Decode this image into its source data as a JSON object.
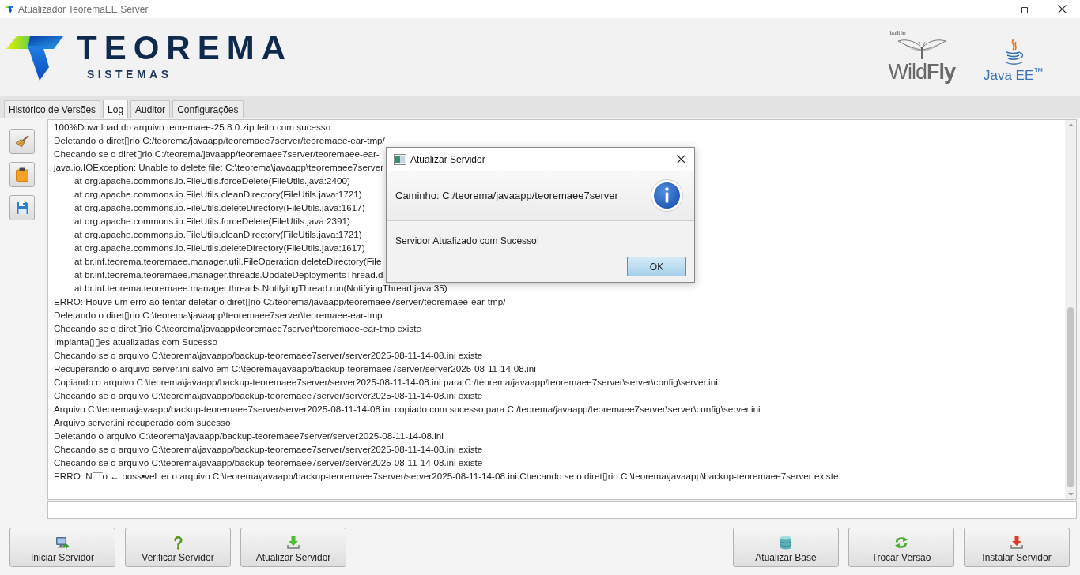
{
  "window": {
    "title": "Atualizador TeoremaEE Server"
  },
  "header": {
    "logo": {
      "name": "TEOREMA",
      "tagline": "SISTEMAS"
    },
    "badges": [
      {
        "kind": "wildfly",
        "caption": "built in",
        "name": "Wild**Fly**"
      },
      {
        "kind": "javaee",
        "name": "Java EE$^{™}$"
      }
    ]
  },
  "tabs": [
    {
      "label": "Histórico de Versões",
      "selected": false
    },
    {
      "label": "Log",
      "selected": true
    },
    {
      "label": "Auditor",
      "selected": false
    },
    {
      "label": "Configurações",
      "selected": false
    }
  ],
  "log": {
    "lines": [
      {
        "kind": "message",
        "text": "100%Download do arquivo teoremaee-25.8.0.zip feito com sucesso"
      },
      {
        "kind": "message",
        "text": "Deletando o diret▯rio C:/teorema/javaapp/teoremaee7server/teoremaee-ear-tmp/"
      },
      {
        "kind": "message",
        "text": "Checando se o diret▯rio C:/teorema/javaapp/teoremaee7server/teoremaee-ear-"
      },
      {
        "kind": "message",
        "text": "java.io.IOException: Unable to delete file: C:\\teorema\\javaapp\\teoremaee7server"
      },
      {
        "kind": "trace",
        "text": "at org.apache.commons.io.FileUtils.forceDelete(FileUtils.java:2400)"
      },
      {
        "kind": "trace",
        "text": "at org.apache.commons.io.FileUtils.cleanDirectory(FileUtils.java:1721)"
      },
      {
        "kind": "trace",
        "text": "at org.apache.commons.io.FileUtils.deleteDirectory(FileUtils.java:1617)"
      },
      {
        "kind": "trace",
        "text": "at org.apache.commons.io.FileUtils.forceDelete(FileUtils.java:2391)"
      },
      {
        "kind": "trace",
        "text": "at org.apache.commons.io.FileUtils.cleanDirectory(FileUtils.java:1721)"
      },
      {
        "kind": "trace",
        "text": "at org.apache.commons.io.FileUtils.deleteDirectory(FileUtils.java:1617)"
      },
      {
        "kind": "trace",
        "text": "at br.inf.teorema.teoremaee.manager.util.FileOperation.deleteDirectory(File"
      },
      {
        "kind": "trace",
        "text": "at br.inf.teorema.teoremaee.manager.threads.UpdateDeploymentsThread.d"
      },
      {
        "kind": "trace",
        "text": "at br.inf.teorema.teoremaee.manager.threads.NotifyingThread.run(NotifyingThread.java:35)"
      },
      {
        "kind": "message",
        "text": "ERRO: Houve um erro ao tentar deletar o diret▯rio C:/teorema/javaapp/teoremaee7server/teoremaee-ear-tmp/"
      },
      {
        "kind": "message",
        "text": "Deletando o diret▯rio C:\\teorema\\javaapp\\teoremaee7server\\teoremaee-ear-tmp"
      },
      {
        "kind": "message",
        "text": "Checando se o diret▯rio C:\\teorema\\javaapp\\teoremaee7server\\teoremaee-ear-tmp existe"
      },
      {
        "kind": "message",
        "text": "Implanta▯▯es atualizadas com Sucesso"
      },
      {
        "kind": "message",
        "text": "Checando se o arquivo C:\\teorema\\javaapp/backup-teoremaee7server/server2025-08-11-14-08.ini existe"
      },
      {
        "kind": "message",
        "text": "Recuperando o arquivo server.ini salvo em C:\\teorema\\javaapp/backup-teoremaee7server/server2025-08-11-14-08.ini"
      },
      {
        "kind": "message",
        "text": "Copiando o arquivo C:\\teorema\\javaapp/backup-teoremaee7server/server2025-08-11-14-08.ini para C:/teorema/javaapp/teoremaee7server\\server\\config\\server.ini"
      },
      {
        "kind": "message",
        "text": "Checando se o arquivo C:\\teorema\\javaapp/backup-teoremaee7server/server2025-08-11-14-08.ini existe"
      },
      {
        "kind": "message",
        "text": "Arquivo C:\\teorema\\javaapp/backup-teoremaee7server/server2025-08-11-14-08.ini copiado com sucesso para C:/teorema/javaapp/teoremaee7server\\server\\config\\server.ini"
      },
      {
        "kind": "message",
        "text": "Arquivo server.ini recuperado com sucesso"
      },
      {
        "kind": "message",
        "text": "Deletando o arquivo C:\\teorema\\javaapp/backup-teoremaee7server/server2025-08-11-14-08.ini"
      },
      {
        "kind": "message",
        "text": "Checando se o arquivo C:\\teorema\\javaapp/backup-teoremaee7server/server2025-08-11-14-08.ini existe"
      },
      {
        "kind": "message",
        "text": "Checando se o arquivo C:\\teorema\\javaapp/backup-teoremaee7server/server2025-08-11-14-08.ini existe"
      },
      {
        "kind": "message",
        "text": "ERRO: N¯¯o ← poss▪vel ler o arquivo C:\\teorema\\javaapp/backup-teoremaee7server/server2025-08-11-14-08.ini.Checando se o diret▯rio C:\\teorema\\javaapp\\backup-teoremaee7server existe"
      }
    ]
  },
  "dialog": {
    "title": "Atualizar Servidor",
    "path": "Caminho: C:/teorema/javaapp/teoremaee7server",
    "message": "Servidor Atualizado com Sucesso!",
    "button": "OK"
  },
  "actions": {
    "left": [
      {
        "kind": "start",
        "label": "Iniciar Servidor"
      },
      {
        "kind": "verify",
        "label": "Verificar Servidor"
      },
      {
        "kind": "update",
        "label": "Atualizar Servidor"
      }
    ],
    "right": [
      {
        "kind": "database",
        "label": "Atualizar Base"
      },
      {
        "kind": "switch",
        "label": "Trocar Versão"
      },
      {
        "kind": "install",
        "label": "Instalar Servidor"
      }
    ]
  }
}
